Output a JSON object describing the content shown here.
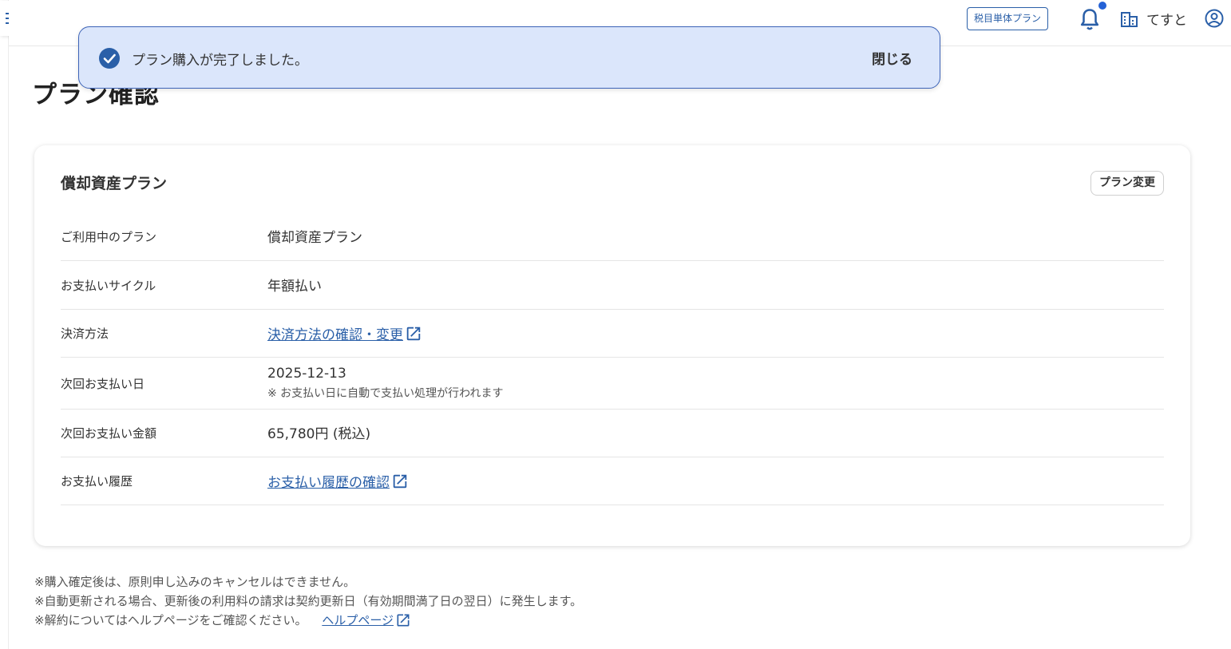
{
  "header": {
    "plan_badge": "税目単体プラン",
    "user_name": "てすと",
    "notification_dot_color": "#2461d6"
  },
  "page": {
    "title": "プラン確認"
  },
  "toast": {
    "message": "プラン購入が完了しました。",
    "close_label": "閉じる"
  },
  "card": {
    "title": "償却資産プラン",
    "change_button": "プラン変更",
    "rows": [
      {
        "label": "ご利用中のプラン",
        "value": "償却資産プラン"
      },
      {
        "label": "お支払いサイクル",
        "value": "年額払い"
      },
      {
        "label": "決済方法",
        "link": "決済方法の確認・変更"
      },
      {
        "label": "次回お支払い日",
        "value": "2025-12-13",
        "note": "※ お支払い日に自動で支払い処理が行われます"
      },
      {
        "label": "次回お支払い金額",
        "value": "65,780円 (税込)"
      },
      {
        "label": "お支払い履歴",
        "link": "お支払い履歴の確認"
      }
    ]
  },
  "notes": {
    "line1": "※購入確定後は、原則申し込みのキャンセルはできません。",
    "line2": "※自動更新される場合、更新後の利用料の請求は契約更新日（有効期間満了日の翌日）に発生します。",
    "line3": "※解約についてはヘルプページをご確認ください。",
    "help_link": "ヘルプページ"
  },
  "colors": {
    "accent": "#2a5fa8",
    "toast_bg": "#dbe6fb",
    "toast_border": "#3d64b8"
  }
}
